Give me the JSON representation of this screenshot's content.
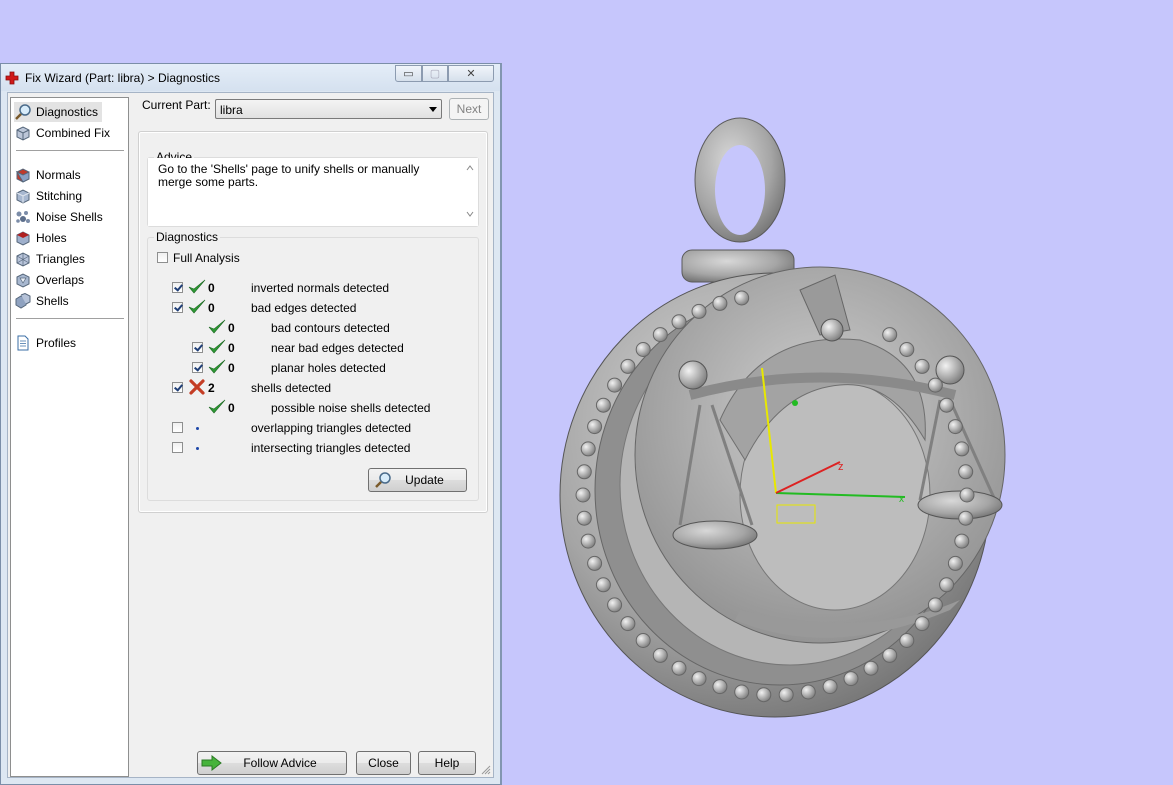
{
  "window": {
    "title": "Fix Wizard (Part: libra) > Diagnostics",
    "minimize_glyph": "▭",
    "maximize_glyph": "▢",
    "close_glyph": "✕"
  },
  "nav": {
    "items": [
      {
        "label": "Diagnostics",
        "icon": "magnifier-icon",
        "selected": true
      },
      {
        "label": "Combined Fix",
        "icon": "cube-icon"
      },
      {
        "label": "Normals",
        "icon": "normals-cube-icon"
      },
      {
        "label": "Stitching",
        "icon": "stitching-cube-icon"
      },
      {
        "label": "Noise Shells",
        "icon": "noise-shells-icon"
      },
      {
        "label": "Holes",
        "icon": "holes-cube-icon"
      },
      {
        "label": "Triangles",
        "icon": "triangles-cube-icon"
      },
      {
        "label": "Overlaps",
        "icon": "overlaps-cube-icon"
      },
      {
        "label": "Shells",
        "icon": "shells-cube-icon"
      },
      {
        "label": "Profiles",
        "icon": "document-icon"
      }
    ]
  },
  "part": {
    "label": "Current Part:",
    "value": "libra",
    "next_label": "Next"
  },
  "advice": {
    "title": "Advice",
    "text": "Go to the 'Shells' page to unify shells or manually merge some parts."
  },
  "diagnostics": {
    "title": "Diagnostics",
    "full_analysis_label": "Full Analysis",
    "rows": [
      {
        "label": "inverted normals detected",
        "count": "0",
        "status": "ok"
      },
      {
        "label": "bad edges detected",
        "count": "0",
        "status": "ok"
      },
      {
        "label": "bad contours detected",
        "count": "0",
        "status": "ok"
      },
      {
        "label": "near bad edges detected",
        "count": "0",
        "status": "ok"
      },
      {
        "label": "planar holes detected",
        "count": "0",
        "status": "ok"
      },
      {
        "label": "shells detected",
        "count": "2",
        "status": "error"
      },
      {
        "label": "possible noise shells detected",
        "count": "0",
        "status": "ok"
      },
      {
        "label": "overlapping triangles detected",
        "count": "",
        "status": "none"
      },
      {
        "label": "intersecting triangles detected",
        "count": "",
        "status": "none"
      }
    ],
    "update_label": "Update"
  },
  "footer": {
    "follow_advice_label": "Follow Advice",
    "close_label": "Close",
    "help_label": "Help"
  },
  "viewport": {
    "axis_labels": {
      "z": "z",
      "x": "x"
    },
    "colors": {
      "background": "#c6c6fc",
      "model": "#a9a9a9",
      "z_axis": "#e8e800",
      "x_axis": "#22bb22",
      "y_axis": "#dd2222"
    }
  }
}
